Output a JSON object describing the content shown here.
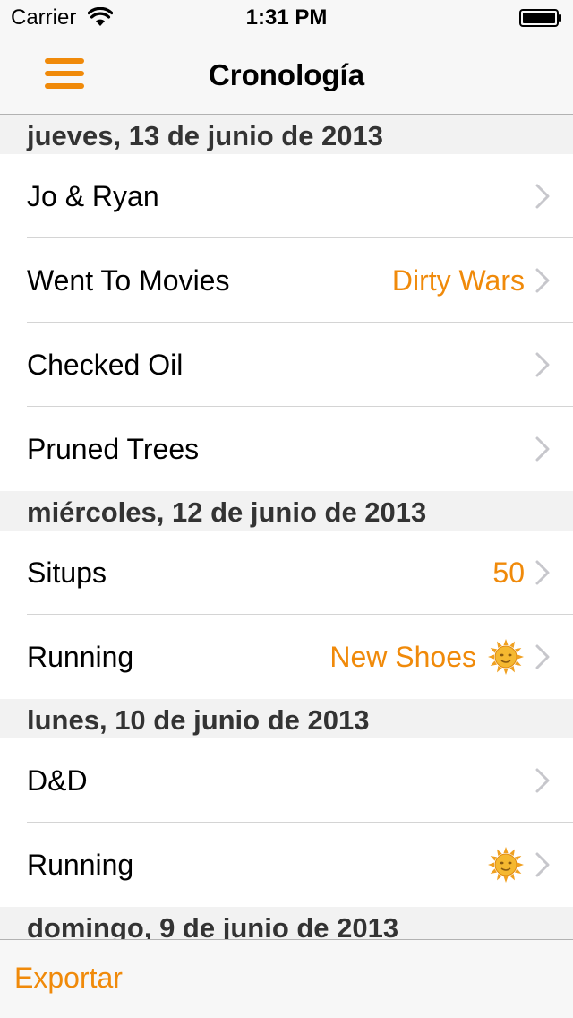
{
  "status_bar": {
    "carrier": "Carrier",
    "time": "1:31 PM"
  },
  "nav": {
    "title": "Cronología",
    "menu_icon": "hamburger-menu-icon"
  },
  "accent_color": "#f08a0a",
  "sections": [
    {
      "header": "jueves, 13 de junio de 2013",
      "rows": [
        {
          "title": "Jo & Ryan",
          "detail": ""
        },
        {
          "title": "Went To Movies",
          "detail": "Dirty Wars"
        },
        {
          "title": "Checked Oil",
          "detail": ""
        },
        {
          "title": "Pruned Trees",
          "detail": ""
        }
      ]
    },
    {
      "header": "miércoles, 12 de junio de 2013",
      "rows": [
        {
          "title": "Situps",
          "detail": "50"
        },
        {
          "title": "Running",
          "detail": "New Shoes",
          "icon": "sun-face-emoji"
        }
      ]
    },
    {
      "header": "lunes, 10 de junio de 2013",
      "rows": [
        {
          "title": "D&D",
          "detail": ""
        },
        {
          "title": "Running",
          "detail": "",
          "icon": "sun-face-emoji"
        }
      ]
    },
    {
      "header": "domingo, 9 de junio de 2013",
      "rows": []
    }
  ],
  "toolbar": {
    "export_label": "Exportar"
  }
}
